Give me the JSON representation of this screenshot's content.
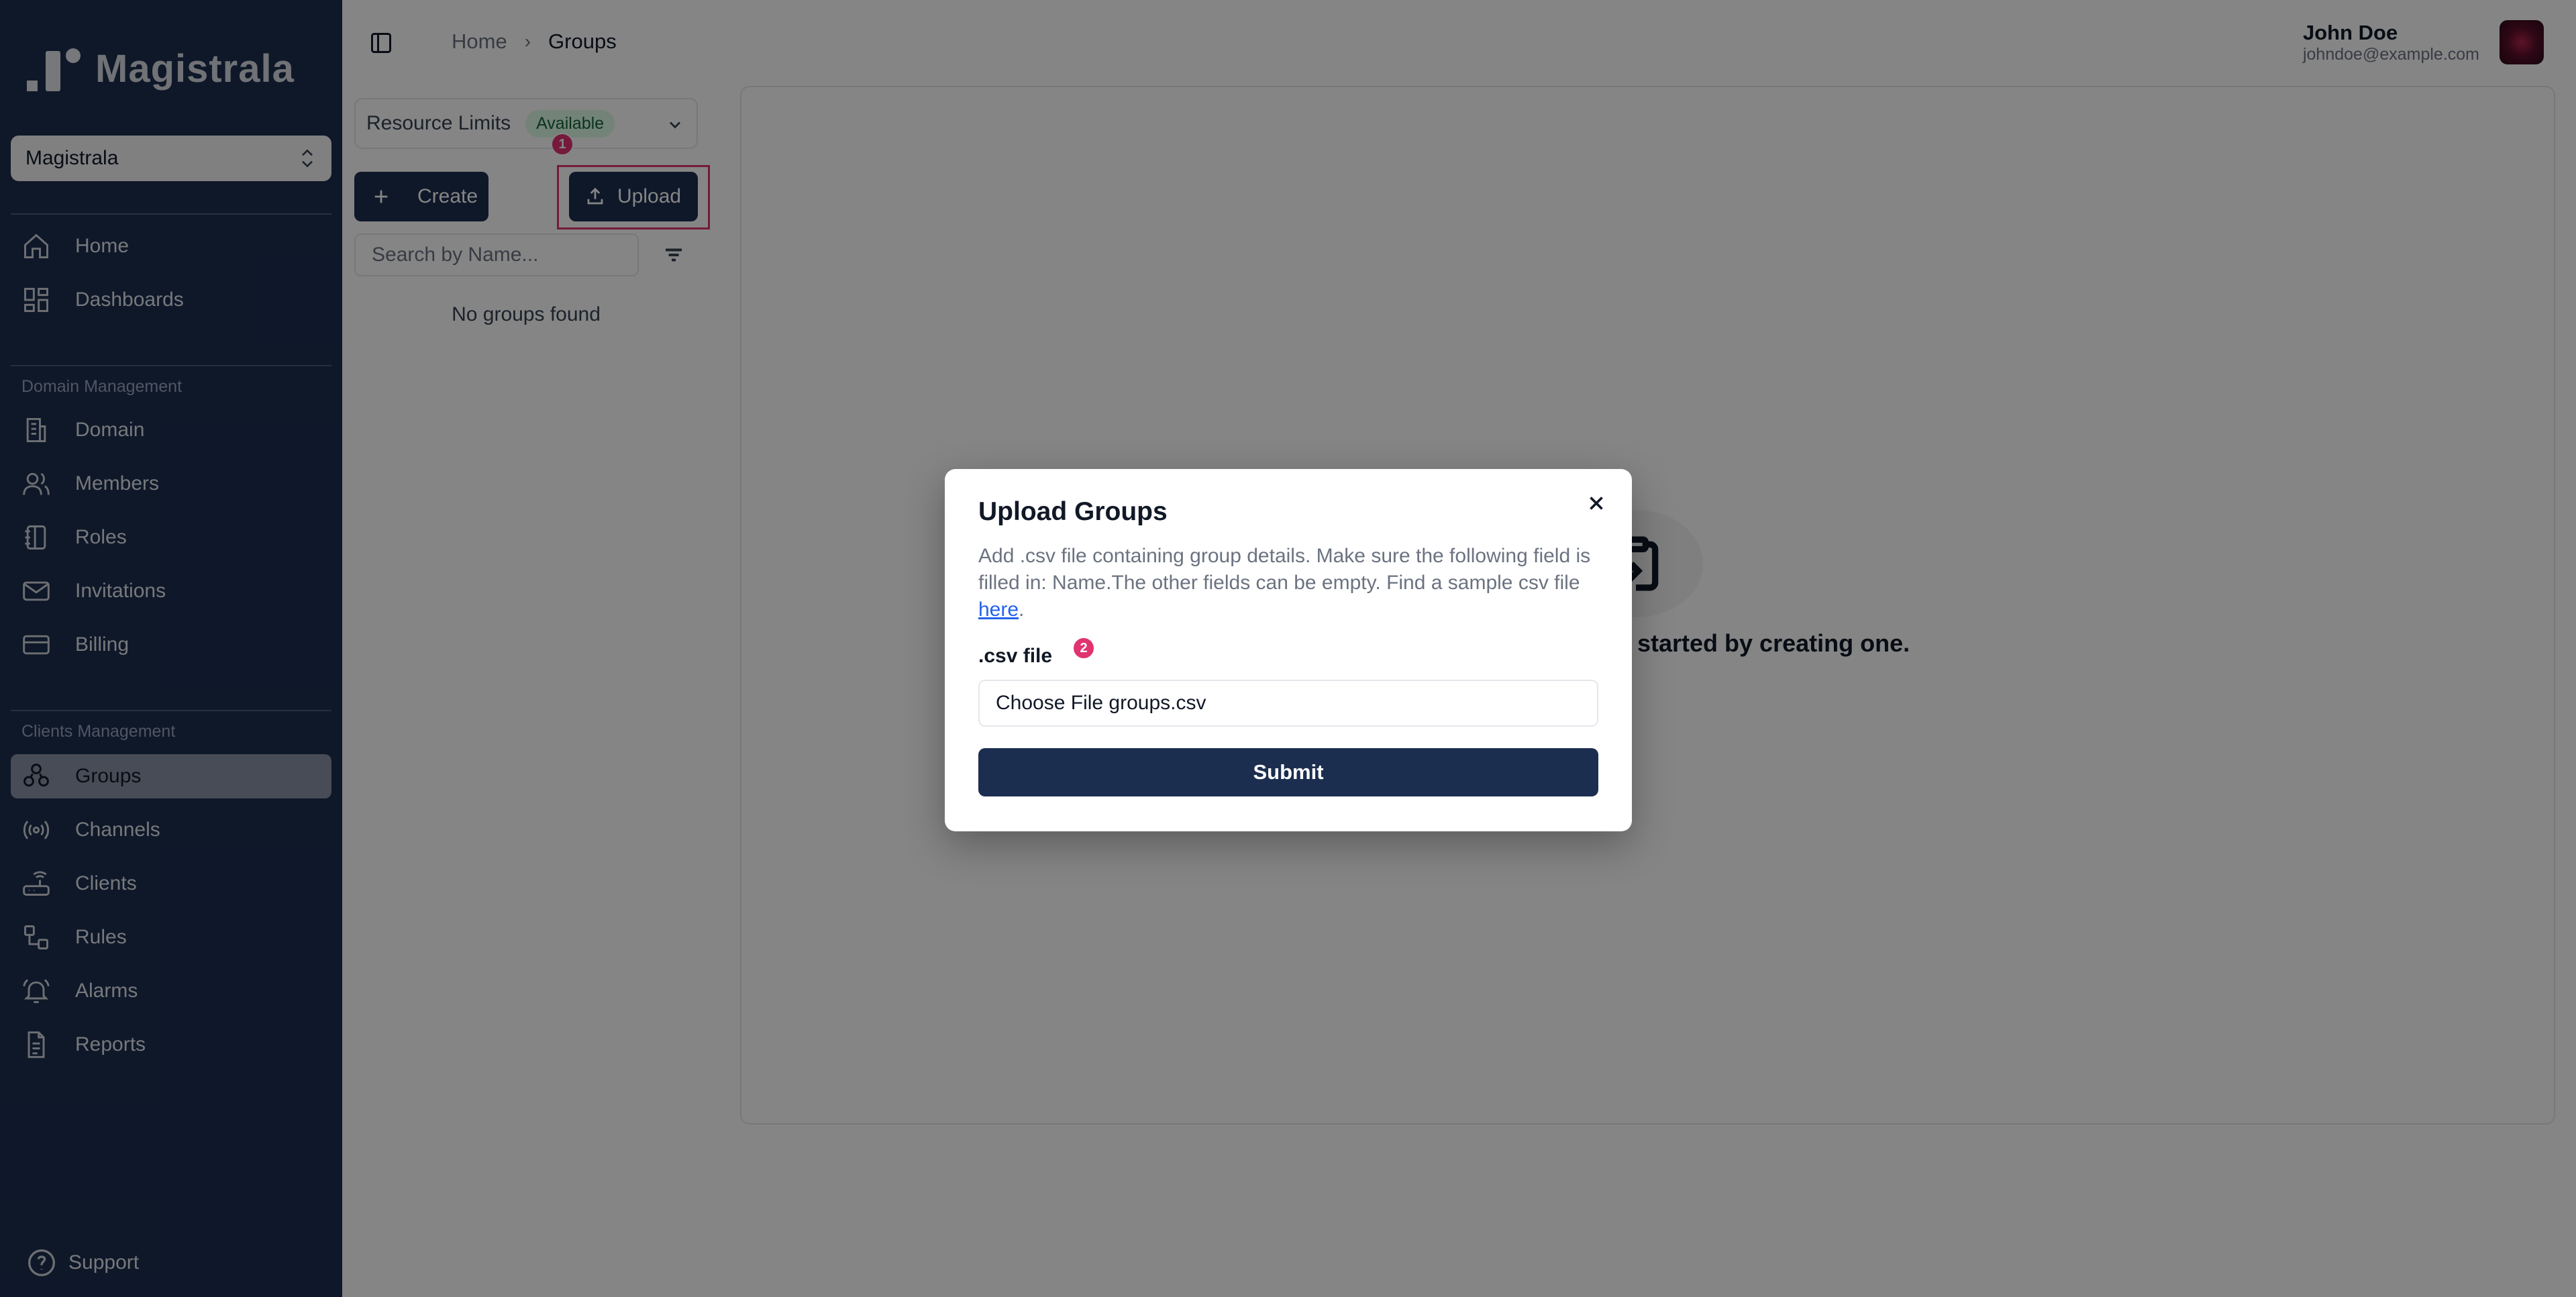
{
  "brand": {
    "name": "Magistrala"
  },
  "workspace": {
    "selected": "Magistrala"
  },
  "sidebar": {
    "top_items": [
      {
        "label": "Home",
        "icon": "home-icon"
      },
      {
        "label": "Dashboards",
        "icon": "dashboard-icon"
      }
    ],
    "domain_section_title": "Domain Management",
    "domain_items": [
      {
        "label": "Domain",
        "icon": "building-icon"
      },
      {
        "label": "Members",
        "icon": "users-icon"
      },
      {
        "label": "Roles",
        "icon": "notebook-icon"
      },
      {
        "label": "Invitations",
        "icon": "mail-icon"
      },
      {
        "label": "Billing",
        "icon": "credit-card-icon"
      }
    ],
    "clients_section_title": "Clients Management",
    "clients_items": [
      {
        "label": "Groups",
        "icon": "groups-icon",
        "active": true
      },
      {
        "label": "Channels",
        "icon": "radio-icon"
      },
      {
        "label": "Clients",
        "icon": "router-icon"
      },
      {
        "label": "Rules",
        "icon": "workflow-icon"
      },
      {
        "label": "Alarms",
        "icon": "bell-ring-icon"
      },
      {
        "label": "Reports",
        "icon": "file-text-icon"
      }
    ],
    "support_label": "Support"
  },
  "header": {
    "breadcrumb_home": "Home",
    "breadcrumb_separator": "›",
    "breadcrumb_current": "Groups",
    "user_name": "John Doe",
    "user_email": "johndoe@example.com"
  },
  "groups_panel": {
    "resource_limits_label": "Resource Limits",
    "resource_limits_status": "Available",
    "create_label": "Create",
    "upload_label": "Upload",
    "search_placeholder": "Search by Name...",
    "empty_text": "No groups found"
  },
  "main": {
    "empty_state_text": "started by creating one."
  },
  "markers": {
    "step1": "1",
    "step2": "2"
  },
  "dialog": {
    "title": "Upload Groups",
    "description_before_link": "Add .csv file containing group details. Make sure the following field is filled in: Name.The other fields can be empty. Find a sample csv file ",
    "link_text": "here",
    "description_after_link": ".",
    "field_label": ".csv file",
    "file_value": "Choose File groups.csv",
    "submit_label": "Submit"
  },
  "colors": {
    "sidebar_bg": "#1c2e50",
    "primary_button": "#1c2e50",
    "highlight": "#e0336f",
    "badge_bg": "#dcfce7",
    "badge_text": "#166534"
  }
}
